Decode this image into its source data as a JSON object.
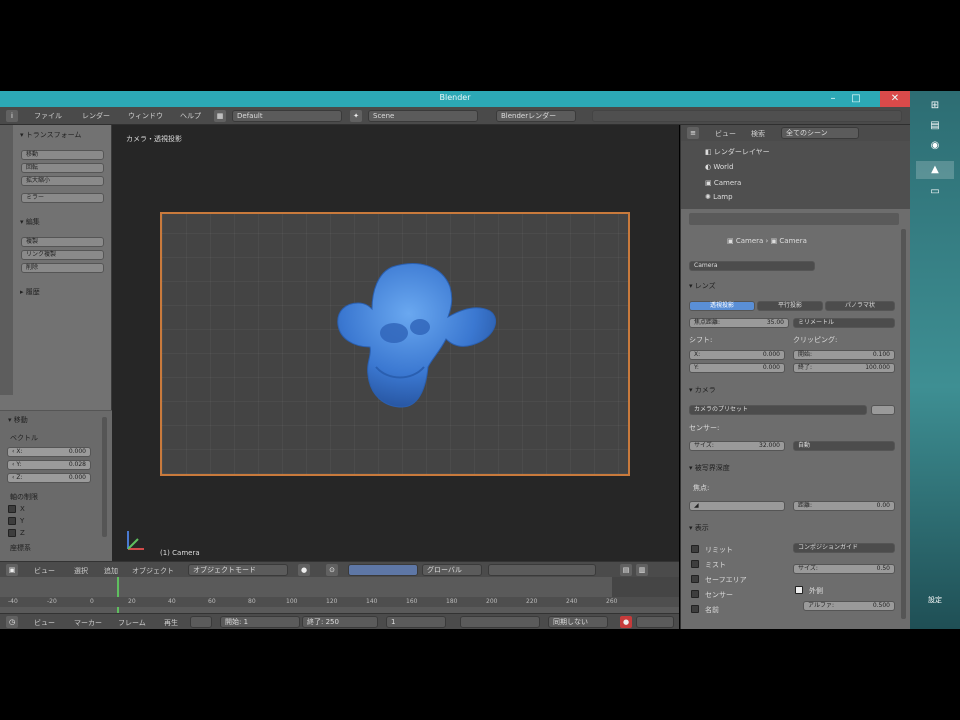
{
  "window": {
    "title": "Blender"
  },
  "menubar": {
    "items": [
      "ファイル",
      "レンダー",
      "ウィンドウ",
      "ヘルプ"
    ],
    "layout": "Default",
    "scene": "Scene",
    "engine": "Blenderレンダー"
  },
  "toolshelf": {
    "transform_header": "トランスフォーム",
    "transform_buttons": [
      "移動",
      "回転",
      "拡大縮小",
      "ミラー"
    ],
    "edit_header": "編集",
    "edit_buttons": [
      "複製",
      "リンク複製",
      "削除"
    ],
    "history_header": "履歴",
    "operator_header": "移動",
    "vector_label": "ベクトル",
    "vector": [
      {
        "axis": "X",
        "value": "0.000"
      },
      {
        "axis": "Y",
        "value": "0.028"
      },
      {
        "axis": "Z",
        "value": "0.000"
      }
    ],
    "constraint_label": "軸の制限",
    "constraints": [
      "X",
      "Y",
      "Z"
    ],
    "orientation_label": "座標系"
  },
  "viewport": {
    "view_label": "カメラ・透視投影",
    "object_label": "(1) Camera"
  },
  "viewport_header": {
    "items": [
      "ビュー",
      "選択",
      "追加",
      "オブジェクト"
    ],
    "mode": "オブジェクトモード",
    "pivot": "グローバル"
  },
  "timeline_header": {
    "items": [
      "ビュー",
      "マーカー",
      "フレーム",
      "再生"
    ],
    "start": "開始: 1",
    "end": "終了: 250",
    "current": "1",
    "sync": "同期しない",
    "ticks": [
      "-40",
      "-20",
      "0",
      "20",
      "40",
      "60",
      "80",
      "100",
      "120",
      "140",
      "160",
      "180",
      "200",
      "220",
      "240",
      "260"
    ]
  },
  "outliner": {
    "tabs": [
      "ビュー",
      "検索",
      "全てのシーン"
    ],
    "rows": [
      "レンダーレイヤー",
      "World",
      "Camera",
      "Lamp"
    ]
  },
  "properties": {
    "breadcrumb": [
      "Camera",
      "Camera"
    ],
    "datablock": "Camera",
    "lens_header": "レンズ",
    "lens_tabs": [
      "透視投影",
      "平行投影",
      "パノラマ状"
    ],
    "focal_label": "焦点距離:",
    "focal_value": "35.00",
    "units": "ミリメートル",
    "shift_label": "シフト:",
    "shift_x": "X:",
    "shift_x_val": "0.000",
    "shift_y": "Y:",
    "shift_y_val": "0.000",
    "clip_label": "クリッピング:",
    "clip_start": "開始:",
    "clip_start_val": "0.100",
    "clip_end": "終了:",
    "clip_end_val": "100.000",
    "camera_header": "カメラ",
    "preset": "カメラのプリセット",
    "sensor_label": "センサー:",
    "sensor_size": "サイズ:",
    "sensor_size_val": "32.000",
    "sensor_fit": "自動",
    "dof_header": "被写界深度",
    "focus_label": "焦点:",
    "distance_label": "距離:",
    "distance_val": "0.00",
    "display_header": "表示",
    "display_items": [
      "リミット",
      "ミスト",
      "セーフエリア",
      "センサー",
      "名前"
    ],
    "composition": "コンポジションガイド",
    "size_label": "サイズ:",
    "size_val": "0.50",
    "passepartout": "外側",
    "alpha_label": "アルファ:",
    "alpha_val": "0.500"
  },
  "taskbar": {
    "items": [
      "⊞",
      "▤",
      "◉",
      "▲",
      "▭"
    ],
    "bottom": "設定"
  }
}
